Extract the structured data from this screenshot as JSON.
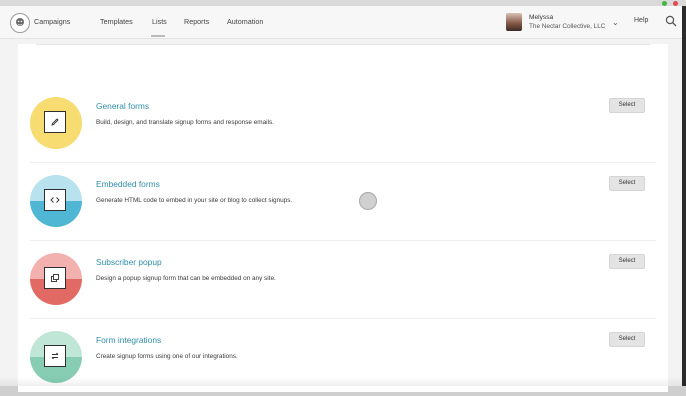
{
  "nav": {
    "items": [
      {
        "label": "Campaigns"
      },
      {
        "label": "Templates"
      },
      {
        "label": "Lists"
      },
      {
        "label": "Reports"
      },
      {
        "label": "Automation"
      }
    ],
    "help": "Help"
  },
  "account": {
    "name": "Melyssa",
    "org": "The Nectar Collective, LLC"
  },
  "forms": [
    {
      "title": "General forms",
      "description": "Build, design, and translate signup forms and response emails.",
      "button": "Select",
      "color_top": "#f7dc72",
      "color_bottom": "#f7dc72",
      "icon": "pencil-icon"
    },
    {
      "title": "Embedded forms",
      "description": "Generate HTML code to embed in your site or blog to collect signups.",
      "button": "Select",
      "color_top": "#b8e3ee",
      "color_bottom": "#4fb6d3",
      "icon": "code-icon"
    },
    {
      "title": "Subscriber popup",
      "description": "Design a popup signup form that can be embedded on any site.",
      "button": "Select",
      "color_top": "#f2b1ae",
      "color_bottom": "#e26a64",
      "icon": "popup-icon"
    },
    {
      "title": "Form integrations",
      "description": "Create signup forms using one of our integrations.",
      "button": "Select",
      "color_top": "#bfe6d7",
      "color_bottom": "#86cdb4",
      "icon": "integration-icon"
    }
  ]
}
